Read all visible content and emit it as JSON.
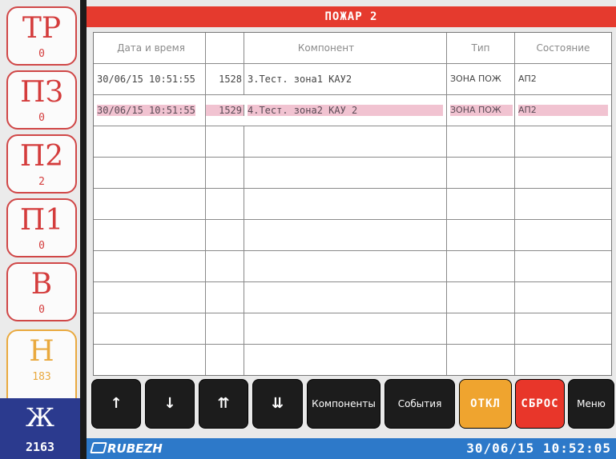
{
  "title": "ПОЖАР 2",
  "status_counters": [
    {
      "code": "ТР",
      "count": "0"
    },
    {
      "code": "ПЗ",
      "count": "0"
    },
    {
      "code": "П2",
      "count": "2"
    },
    {
      "code": "П1",
      "count": "0"
    },
    {
      "code": "В",
      "count": "0"
    },
    {
      "code": "Н",
      "count": "183"
    },
    {
      "code": "Ж",
      "count": "2163"
    }
  ],
  "table": {
    "headers": {
      "datetime": "Дата и время",
      "component": "Компонент",
      "type": "Тип",
      "state": "Состояние"
    },
    "rows": [
      {
        "datetime": "30/06/15 10:51:55",
        "num": "1528",
        "component": "3.Тест. зона1 КАУ2",
        "type": "ЗОНА ПОЖ",
        "state": "АП2"
      },
      {
        "datetime": "30/06/15 10:51:55",
        "num": "1529",
        "component": "4.Тест. зона2 КАУ 2",
        "type": "ЗОНА ПОЖ",
        "state": "АП2"
      }
    ]
  },
  "buttons": {
    "up": "↑",
    "down": "↓",
    "page_up": "⇈",
    "page_down": "⇊",
    "components": "Компоненты",
    "events": "События",
    "disable": "ОТКЛ",
    "reset": "СБРОС",
    "menu": "Меню"
  },
  "footer": {
    "logo": "RUBEZH",
    "datetime": "30/06/15 10:52:05"
  },
  "colors": {
    "alarm_red": "#e53a2e",
    "accent_orange": "#efa42f",
    "footer_blue": "#2d79c9",
    "selected_row": "#f1c3d1"
  }
}
